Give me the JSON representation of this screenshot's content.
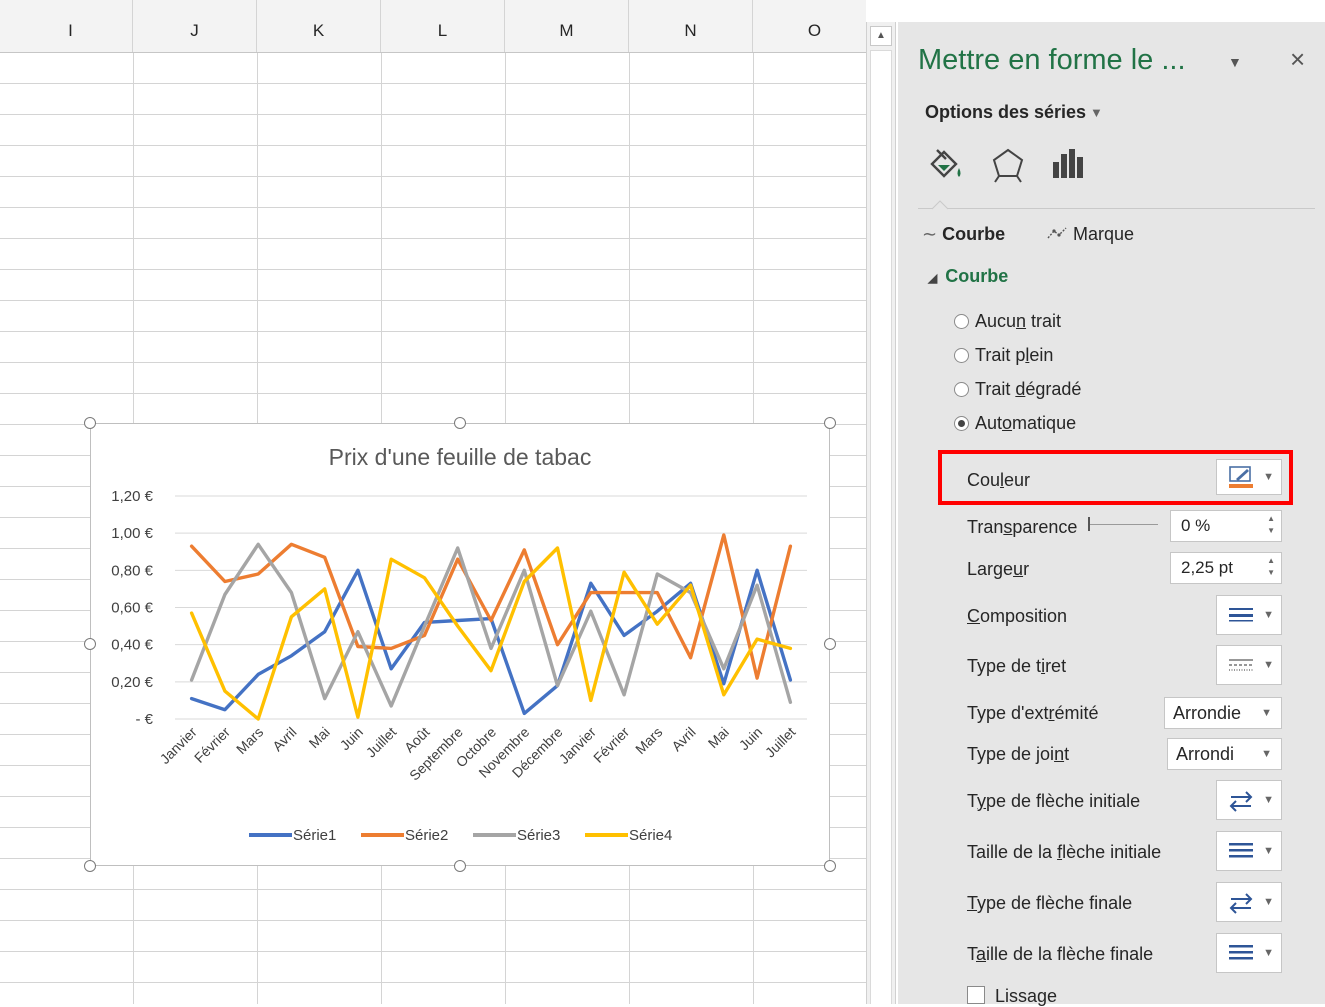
{
  "sheet": {
    "columns": [
      "I",
      "J",
      "K",
      "L",
      "M",
      "N",
      "O"
    ]
  },
  "chart_data": {
    "type": "line",
    "title": "Prix d'une feuille de tabac",
    "categories": [
      "Janvier",
      "Février",
      "Mars",
      "Avril",
      "Mai",
      "Juin",
      "Juillet",
      "Août",
      "Septembre",
      "Octobre",
      "Novembre",
      "Décembre",
      "Janvier",
      "Février",
      "Mars",
      "Avril",
      "Mai",
      "Juin",
      "Juillet"
    ],
    "y_ticks": [
      "1,20 €",
      "1,00 €",
      "0,80 €",
      "0,60 €",
      "0,40 €",
      "0,20 €",
      "-   €"
    ],
    "ylim": [
      0,
      1.2
    ],
    "legend_position": "bottom",
    "grid": true,
    "series": [
      {
        "name": "Série1",
        "color": "#4472c4",
        "values": [
          0.11,
          0.05,
          0.24,
          0.34,
          0.47,
          0.8,
          0.27,
          0.52,
          0.53,
          0.54,
          0.03,
          0.18,
          0.73,
          0.45,
          0.58,
          0.73,
          0.19,
          0.8,
          0.21
        ]
      },
      {
        "name": "Série2",
        "color": "#ed7d31",
        "values": [
          0.93,
          0.74,
          0.78,
          0.94,
          0.87,
          0.39,
          0.38,
          0.45,
          0.86,
          0.53,
          0.91,
          0.4,
          0.68,
          0.68,
          0.68,
          0.33,
          0.99,
          0.22,
          0.93
        ]
      },
      {
        "name": "Série3",
        "color": "#a5a5a5",
        "values": [
          0.21,
          0.67,
          0.94,
          0.68,
          0.11,
          0.47,
          0.07,
          0.5,
          0.92,
          0.38,
          0.8,
          0.18,
          0.58,
          0.13,
          0.78,
          0.68,
          0.27,
          0.72,
          0.09
        ]
      },
      {
        "name": "Série4",
        "color": "#ffc000",
        "values": [
          0.57,
          0.15,
          0.0,
          0.55,
          0.7,
          0.01,
          0.86,
          0.76,
          0.5,
          0.26,
          0.74,
          0.92,
          0.1,
          0.79,
          0.51,
          0.72,
          0.13,
          0.43,
          0.38
        ]
      }
    ]
  },
  "pane": {
    "title": "Mettre en forme le ...",
    "series_options": "Options des séries",
    "tabs": {
      "fill": "fill-line-icon",
      "effects": "effects-pentagon-icon",
      "series": "series-options-icon"
    },
    "sub_tabs": {
      "line": "Courbe",
      "marker": "Marque"
    },
    "section": "Courbe",
    "radios": [
      {
        "pre": "Aucu",
        "u": "n",
        "post": " trait",
        "checked": false
      },
      {
        "pre": "Trait p",
        "u": "l",
        "post": "ein",
        "checked": false
      },
      {
        "pre": "Trait ",
        "u": "d",
        "post": "égradé",
        "checked": false
      },
      {
        "pre": "Aut",
        "u": "o",
        "post": "matique",
        "checked": true
      }
    ],
    "color": {
      "pre": "Cou",
      "u": "l",
      "post": "eur",
      "swatch": "#ed7d31"
    },
    "transparency": {
      "pre": "Tran",
      "u": "s",
      "post": "parence",
      "value": "0 %"
    },
    "width": {
      "pre": "Large",
      "u": "u",
      "post": "r",
      "value": "2,25 pt"
    },
    "compound": {
      "pre": "",
      "u": "C",
      "post": "omposition"
    },
    "dash": {
      "pre": "Type de t",
      "u": "i",
      "post": "ret"
    },
    "cap": {
      "pre": "Type d'ext",
      "u": "r",
      "post": "émité",
      "value": "Arrondie"
    },
    "join": {
      "pre": "Type de joi",
      "u": "n",
      "post": "t",
      "value": "Arrondi"
    },
    "begin_arrow_type": {
      "pre": "T",
      "u": "y",
      "post": "pe de flèche initiale"
    },
    "begin_arrow_size": {
      "pre": "Taille de la ",
      "u": "f",
      "post": "lèche initiale"
    },
    "end_arrow_type": {
      "pre": "",
      "u": "T",
      "post": "ype de flèche finale"
    },
    "end_arrow_size": {
      "pre": "T",
      "u": "a",
      "post": "ille de la flèche finale"
    },
    "smoothing": "Lissage",
    "close": "×"
  },
  "colors": {
    "accent_green": "#217346",
    "highlight": "#ff0000"
  }
}
